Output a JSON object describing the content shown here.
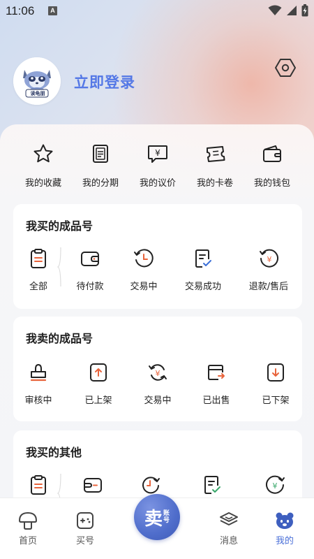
{
  "status_bar": {
    "time": "11:06",
    "notif_letter": "A"
  },
  "header": {
    "login_text": "立即登录",
    "avatar_caption": "读龟朋"
  },
  "quick_actions": [
    {
      "label": "我的收藏",
      "icon": "star-icon"
    },
    {
      "label": "我的分期",
      "icon": "installment-icon"
    },
    {
      "label": "我的议价",
      "icon": "bargain-icon"
    },
    {
      "label": "我的卡卷",
      "icon": "coupon-icon"
    },
    {
      "label": "我的钱包",
      "icon": "wallet-icon"
    }
  ],
  "buy_finished": {
    "title": "我买的成品号",
    "items": [
      {
        "label": "全部",
        "icon": "clipboard-icon"
      },
      {
        "label": "待付款",
        "icon": "wallet-pay-icon"
      },
      {
        "label": "交易中",
        "icon": "clock-icon"
      },
      {
        "label": "交易成功",
        "icon": "check-doc-icon"
      },
      {
        "label": "退款/售后",
        "icon": "refund-icon"
      }
    ]
  },
  "sell_finished": {
    "title": "我卖的成品号",
    "items": [
      {
        "label": "审核中",
        "icon": "stamp-icon"
      },
      {
        "label": "已上架",
        "icon": "arrow-up-icon"
      },
      {
        "label": "交易中",
        "icon": "exchange-icon"
      },
      {
        "label": "已出售",
        "icon": "sold-box-icon"
      },
      {
        "label": "已下架",
        "icon": "arrow-down-icon"
      }
    ]
  },
  "buy_other": {
    "title": "我买的其他"
  },
  "bottom_nav": {
    "home": "首页",
    "buy": "买号",
    "sell_main": "卖",
    "sell_sub_1": "账",
    "sell_sub_2": "号",
    "messages": "消息",
    "mine": "我的"
  },
  "colors": {
    "accent": "#4a6fd8",
    "login": "#5478e6",
    "icon_red": "#e8643c"
  }
}
